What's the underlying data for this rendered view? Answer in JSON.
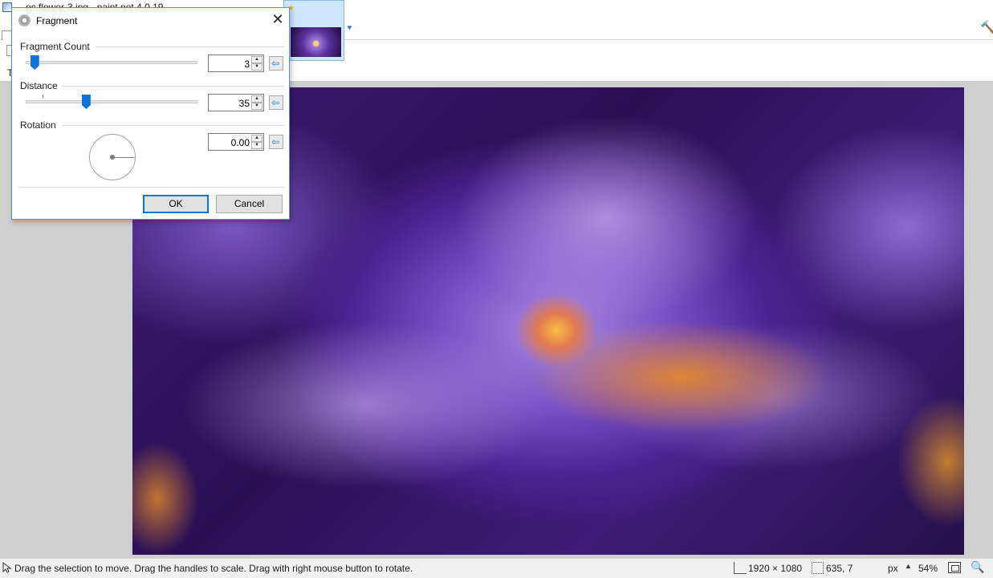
{
  "app": {
    "title_fragment": "...oc.flower-3.jpg - paint.net 4.0.19"
  },
  "toolbar": {
    "partial_label": "T"
  },
  "image_tab": {
    "thumbnail": "purple-crocus-flower"
  },
  "dialog": {
    "title": "Fragment",
    "fragment_count": {
      "label": "Fragment Count",
      "value": "3",
      "slider_fraction": 0.05
    },
    "distance": {
      "label": "Distance",
      "value": "35",
      "slider_fraction": 0.35
    },
    "rotation": {
      "label": "Rotation",
      "value": "0.00",
      "angle_degrees": 0
    },
    "ok_label": "OK",
    "cancel_label": "Cancel"
  },
  "status": {
    "hint": "Drag the selection to move. Drag the handles to scale. Drag with right mouse button to rotate.",
    "image_size": "1920 × 1080",
    "cursor_position": "635, 7",
    "units": "px",
    "zoom": "54%"
  },
  "colors": {
    "accent": "#0078d7",
    "slider_thumb": "#0a74da",
    "dialog_border": "#5a8fc7"
  },
  "icons": [
    "effect-gear-icon",
    "close-icon",
    "reset-arrow-icon",
    "cursor-icon",
    "image-size-icon",
    "cursor-position-icon",
    "zoom-fit-icon",
    "zoom-out-icon",
    "tab-dropdown-icon",
    "hammer-icon"
  ]
}
